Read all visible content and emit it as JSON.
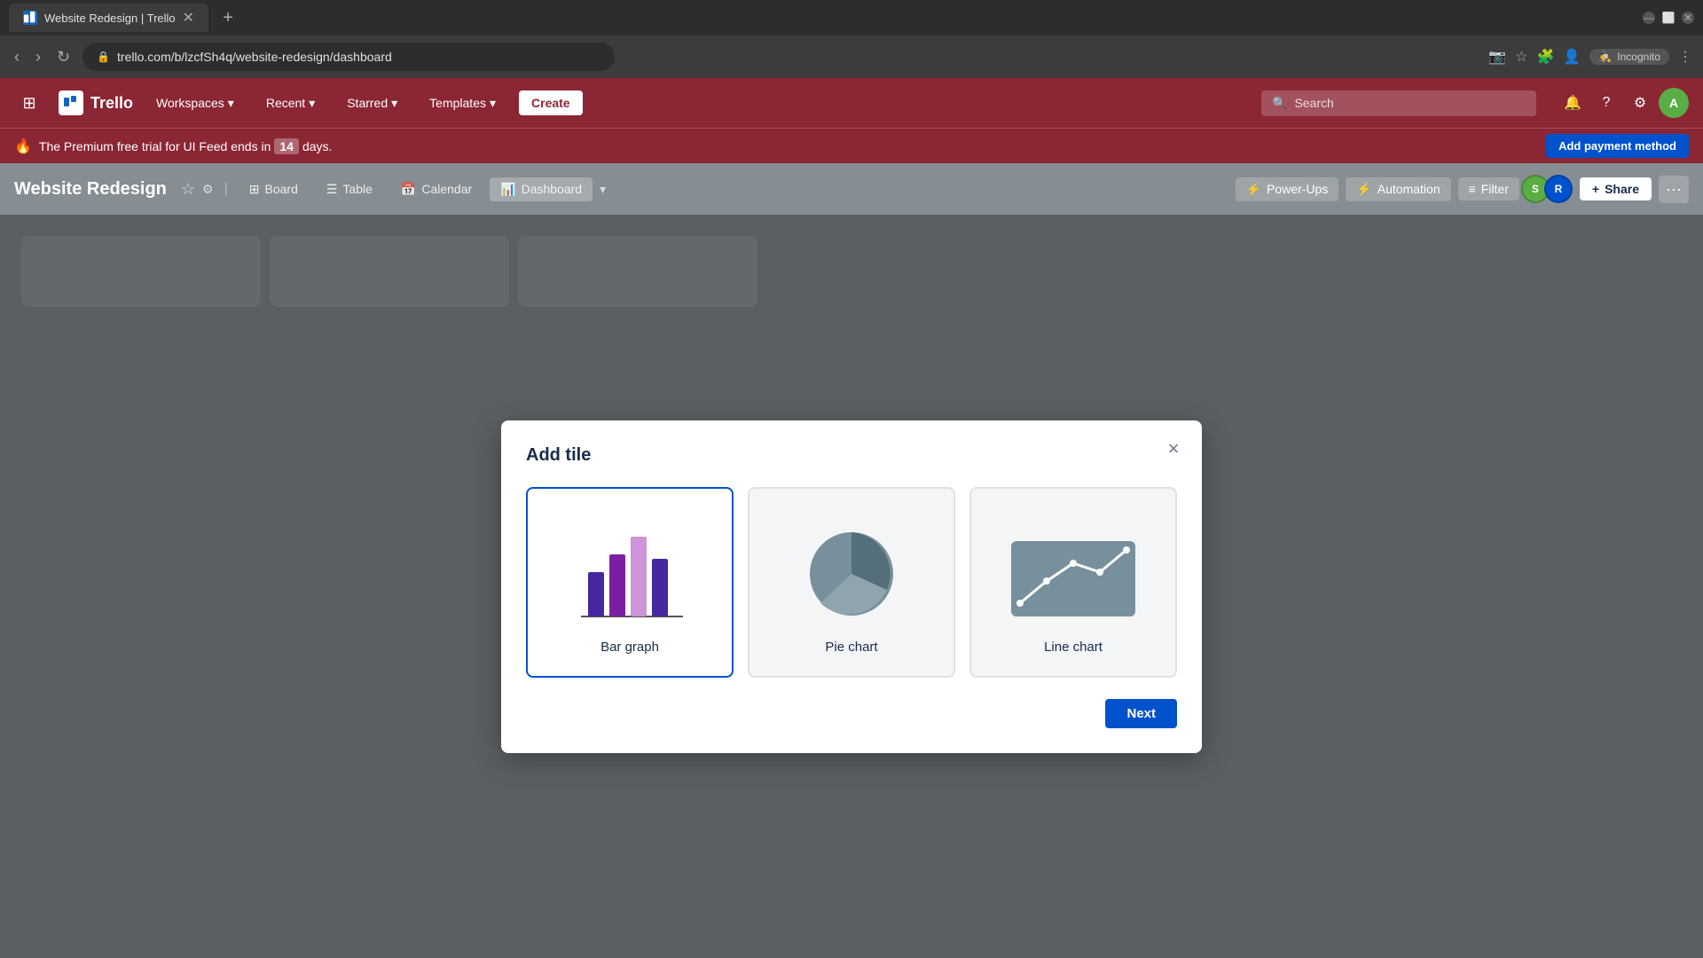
{
  "browser": {
    "tab_title": "Website Redesign | Trello",
    "tab_favicon": "T",
    "url": "trello.com/b/lzcfSh4q/website-redesign/dashboard",
    "incognito_label": "Incognito"
  },
  "nav": {
    "logo_text": "Trello",
    "workspaces_label": "Workspaces",
    "recent_label": "Recent",
    "starred_label": "Starred",
    "templates_label": "Templates",
    "create_label": "Create",
    "search_placeholder": "Search"
  },
  "banner": {
    "text_before": "The Premium free trial for UI Feed ends in",
    "days": "14",
    "text_after": "days.",
    "payment_btn": "Add payment method"
  },
  "board_header": {
    "title": "Website Redesign",
    "views": [
      "Board",
      "Table",
      "Calendar",
      "Dashboard"
    ],
    "active_view": "Dashboard",
    "power_ups": "Power-Ups",
    "automation": "Automation",
    "filter": "Filter",
    "share": "Share"
  },
  "modal": {
    "title": "Add tile",
    "close_icon": "×",
    "options": [
      {
        "label": "Bar graph",
        "selected": true
      },
      {
        "label": "Pie chart",
        "selected": false
      },
      {
        "label": "Line chart",
        "selected": false
      }
    ],
    "next_btn": "Next"
  }
}
